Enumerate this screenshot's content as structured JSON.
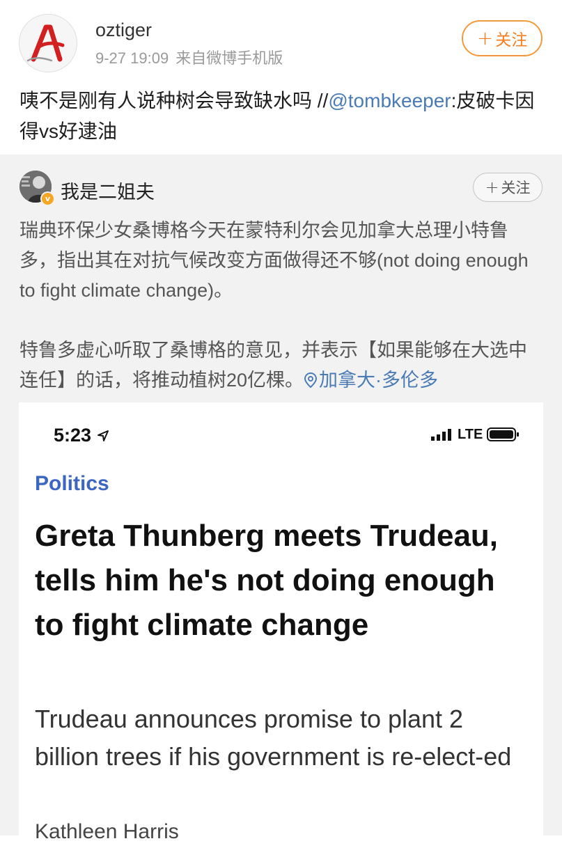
{
  "post": {
    "author": "oztiger",
    "time": "9-27 19:09",
    "source": "来自微博手机版",
    "follow_label": "关注",
    "text_before_mention": "咦不是刚有人说种树会导致缺水吗 //",
    "mention": "@tombkeeper",
    "text_after_mention": ":皮破卡因得vs好逮油"
  },
  "repost": {
    "author": "我是二姐夫",
    "follow_label": "关注",
    "paragraph1": "瑞典环保少女桑博格今天在蒙特利尔会见加拿大总理小特鲁多，指出其在对抗气候改变方面做得还不够(not doing enough to fight climate change)。",
    "paragraph2": "特鲁多虚心听取了桑博格的意见，并表示【如果能够在大选中连任】的话，将推动植树20亿棵。",
    "location": "加拿大·多伦多"
  },
  "embedded": {
    "status_time": "5:23",
    "network": "LTE",
    "category": "Politics",
    "headline": "Greta Thunberg meets Trudeau, tells him he's not doing enough to fight climate change",
    "subheadline": "Trudeau announces promise to plant 2 billion trees if his government is re-elect-ed",
    "byline": "Kathleen Harris"
  },
  "colors": {
    "follow_orange": "#f47d20",
    "link_blue": "#4a7bb5",
    "category_blue": "#3b67c2",
    "repost_bg": "#f2f2f2"
  }
}
